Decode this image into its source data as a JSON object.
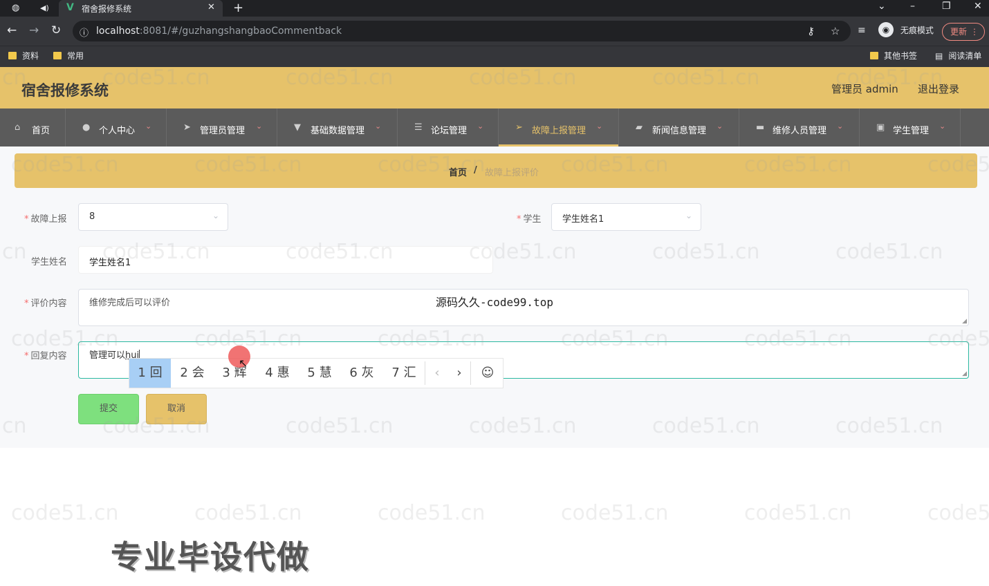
{
  "browser": {
    "tab_title": "宿舍报修系统",
    "url_host": "localhost",
    "url_rest": ":8081/#/guzhangshangbaoCommentback",
    "incognito_label": "无痕模式",
    "update_label": "更新",
    "bookmarks": [
      "资料",
      "常用"
    ],
    "bookmarks_right": [
      "其他书签",
      "阅读清单"
    ]
  },
  "header": {
    "title": "宿舍报修系统",
    "admin_label": "管理员 admin",
    "logout_label": "退出登录"
  },
  "menu": {
    "items": [
      {
        "label": "首页",
        "icon": "home-icon"
      },
      {
        "label": "个人中心",
        "icon": "user-icon"
      },
      {
        "label": "管理员管理",
        "icon": "send-icon"
      },
      {
        "label": "基础数据管理",
        "icon": "trophy-icon"
      },
      {
        "label": "论坛管理",
        "icon": "sliders-icon"
      },
      {
        "label": "故障上报管理",
        "icon": "navigation-icon"
      },
      {
        "label": "新闻信息管理",
        "icon": "wallet-icon"
      },
      {
        "label": "维修人员管理",
        "icon": "monitor-icon"
      },
      {
        "label": "学生管理",
        "icon": "chat-icon"
      }
    ],
    "active": "故障上报管理"
  },
  "breadcrumb": {
    "home": "首页",
    "separator": "/",
    "current": "故障上报评价"
  },
  "form": {
    "fault_label": "故障上报",
    "fault_value": "8",
    "student_label": "学生",
    "student_value": "学生姓名1",
    "student_name_label": "学生姓名",
    "student_name_value": "学生姓名1",
    "comment_label": "评价内容",
    "comment_value": "维修完成后可以评价",
    "reply_label": "回复内容",
    "reply_value": "管理可以",
    "reply_pinyin": "hui",
    "submit_label": "提交",
    "cancel_label": "取消"
  },
  "ime": {
    "candidates": [
      "1 回",
      "2 会",
      "3 辉",
      "4 惠",
      "5 慧",
      "6 灰",
      "7 汇"
    ],
    "prev": "‹",
    "next": "›",
    "emoji": "☺"
  },
  "overlay": {
    "source_text": "源码久久-code99.top",
    "promo_text": "专业毕设代做",
    "watermark": "code51.cn"
  },
  "colors": {
    "brand_yellow": "#e6c26a",
    "menu_bg": "#5b5b5b",
    "submit_green": "#7ee07e",
    "focus_teal": "#2bb8a0"
  }
}
